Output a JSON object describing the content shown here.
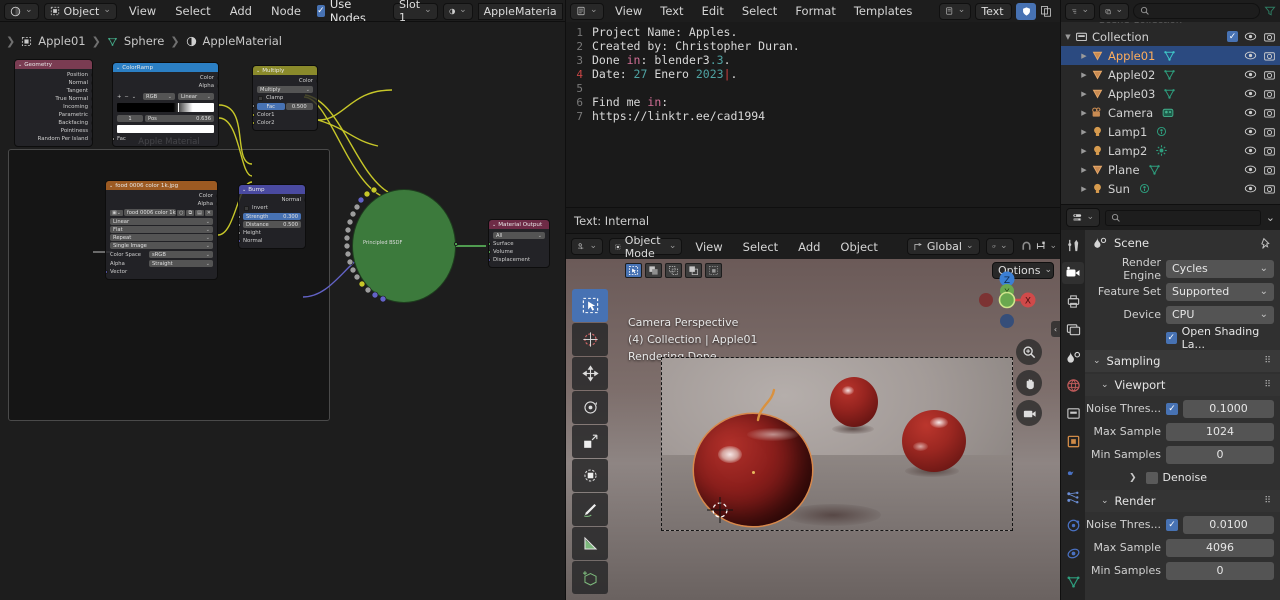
{
  "node_editor": {
    "header": {
      "editor_type_icon": "shader-editor-icon",
      "shader_type": "Object",
      "menus": [
        "View",
        "Select",
        "Add",
        "Node"
      ],
      "use_nodes_label": "Use Nodes",
      "use_nodes_checked": true,
      "slot": "Slot 1",
      "material_icon": "material-icon",
      "material_name": "AppleMateria"
    },
    "breadcrumb": [
      {
        "icon": "object-icon",
        "label": "Apple01"
      },
      {
        "icon": "mesh-data-icon",
        "label": "Sphere"
      },
      {
        "icon": "material-icon",
        "label": "AppleMaterial"
      }
    ],
    "frame_label": "Apple Material",
    "nodes": [
      {
        "name": "Geometry",
        "title": "Geometry",
        "header_color": "#7a3c52",
        "outputs": [
          "Position",
          "Normal",
          "Tangent",
          "True Normal",
          "Incoming",
          "Parametric",
          "Backfacing",
          "Pointiness",
          "Random Per Island"
        ]
      },
      {
        "name": "ColorRamp",
        "title": "ColorRamp",
        "header_color": "#2b7fc4",
        "outputs": [
          "Color",
          "Alpha"
        ],
        "interp_mode": "RGB",
        "interp_type": "Linear",
        "stop_index": "1",
        "pos_label": "Pos",
        "pos_value": "0.636",
        "inputs": [
          "Fac"
        ]
      },
      {
        "name": "Multiply",
        "title": "Multiply",
        "header_color": "#8a8a2b",
        "outputs": [
          "Color"
        ],
        "blend_mode": "Multiply",
        "clamp_label": "Clamp",
        "clamp_checked": false,
        "fac_label": "Fac",
        "fac_value": "0.500",
        "inputs": [
          "Color1",
          "Color2"
        ]
      },
      {
        "name": "ImageTexture",
        "title": "food 0006 color 1k.jpg",
        "header_color": "#9c5a22",
        "outputs": [
          "Color",
          "Alpha"
        ],
        "image_name": "food 0006 color 1k...",
        "interpolation": "Linear",
        "projection": "Flat",
        "extension": "Repeat",
        "source": "Single Image",
        "color_space_label": "Color Space",
        "color_space": "sRGB",
        "alpha_label": "Alpha",
        "alpha_mode": "Straight",
        "inputs": [
          "Vector"
        ]
      },
      {
        "name": "Bump",
        "title": "Bump",
        "header_color": "#4a4aa0",
        "outputs": [
          "Normal"
        ],
        "invert_label": "Invert",
        "invert_checked": false,
        "strength_label": "Strength",
        "strength_value": "0.300",
        "distance_label": "Distance",
        "distance_value": "0.500",
        "inputs": [
          "Height",
          "Normal"
        ]
      },
      {
        "name": "PrincipledBSDF",
        "title": "Principled BSDF",
        "collapsed": true,
        "body_color": "#3c7a3c"
      },
      {
        "name": "MaterialOutput",
        "title": "Material Output",
        "header_color": "#6e2b46",
        "target": "All",
        "inputs": [
          "Surface",
          "Volume",
          "Displacement"
        ]
      }
    ]
  },
  "text_editor": {
    "header": {
      "editor_type_icon": "text-editor-icon",
      "menus": [
        "View",
        "Text",
        "Edit",
        "Select",
        "Format",
        "Templates"
      ],
      "datablock_icon": "text-datablock-icon",
      "datablock_name": "Text",
      "register_checked": true,
      "copy_icon": "duplicate-icon"
    },
    "lines": [
      {
        "n": "1",
        "text": "Project Name: Apples."
      },
      {
        "n": "2",
        "text": "Created by: Christopher Duran."
      },
      {
        "n": "3",
        "text": "Done in: blender3.3."
      },
      {
        "n": "4",
        "text": "Date: 27 Enero 2023."
      },
      {
        "n": "5",
        "text": ""
      },
      {
        "n": "6",
        "text": "Find me in:"
      },
      {
        "n": "7",
        "text": "https://linktr.ee/cad1994"
      }
    ],
    "current_line": "4",
    "status": "Text: Internal"
  },
  "viewport": {
    "header": {
      "mode_icon": "object-mode-icon",
      "mode": "Object Mode",
      "menus": [
        "View",
        "Select",
        "Add",
        "Object"
      ],
      "transform_orientation_icon": "orientation-icon",
      "transform_orientation": "Global",
      "snap_icon": "magnet-icon",
      "pivot_icon": "pivot-icon",
      "proportional_icon": "proportional-edit-icon"
    },
    "select_modes": [
      "set-select-icon",
      "extend-select-icon",
      "subtract-select-icon",
      "invert-select-icon",
      "intersect-select-icon"
    ],
    "options_label": "Options",
    "overlay": {
      "view_name": "Camera Perspective",
      "collection_info": "(4) Collection | Apple01",
      "render_status": "Rendering Done"
    },
    "toolbar": [
      "tweak-select-box-icon",
      "cursor-icon",
      "move-icon",
      "rotate-icon",
      "scale-icon",
      "transform-icon",
      "annotate-icon",
      "measure-icon",
      "add-cube-icon"
    ],
    "gizmo_axes": [
      "X",
      "Y",
      "Z"
    ],
    "nav_buttons": [
      "zoom-icon",
      "pan-hand-icon",
      "camera-view-icon"
    ]
  },
  "outliner": {
    "header": {
      "editor_type_icon": "outliner-icon",
      "display_mode_icon": "view-layer-icon",
      "search_placeholder": "",
      "filter_icon": "filter-icon"
    },
    "root": {
      "label": "Collection",
      "icon": "collection-icon",
      "checked": true
    },
    "items": [
      {
        "label": "Apple01",
        "icon": "mesh-object-icon",
        "data_icon": "mesh-data-icon",
        "selected": true
      },
      {
        "label": "Apple02",
        "icon": "mesh-object-icon",
        "data_icon": "mesh-data-icon",
        "selected": false
      },
      {
        "label": "Apple03",
        "icon": "mesh-object-icon",
        "data_icon": "mesh-data-icon",
        "selected": false
      },
      {
        "label": "Camera",
        "icon": "camera-object-icon",
        "data_icon": "camera-data-icon",
        "selected": false
      },
      {
        "label": "Lamp1",
        "icon": "light-object-icon",
        "data_icon": "point-light-icon",
        "selected": false
      },
      {
        "label": "Lamp2",
        "icon": "light-object-icon",
        "data_icon": "sun-light-icon",
        "selected": false
      },
      {
        "label": "Plane",
        "icon": "mesh-object-icon",
        "data_icon": "mesh-data-icon",
        "selected": false
      },
      {
        "label": "Sun",
        "icon": "light-object-icon",
        "data_icon": "point-light-icon",
        "selected": false
      }
    ]
  },
  "properties": {
    "header": {
      "editor_type_icon": "properties-icon",
      "search_placeholder": "",
      "expand_icon": "chevron-down-icon"
    },
    "tabs": [
      "tool-icon",
      "render-icon",
      "output-icon",
      "view-layer-icon",
      "scene-icon",
      "world-icon",
      "collection-icon",
      "object-icon",
      "modifiers-icon",
      "particles-icon",
      "physics-icon",
      "constraints-icon",
      "data-icon"
    ],
    "active_tab_index": 1,
    "breadcrumb": {
      "icon": "scene-icon",
      "label": "Scene",
      "pin_icon": "pin-icon"
    },
    "fields": [
      {
        "label": "Render Engine",
        "value": "Cycles",
        "type": "dropdown"
      },
      {
        "label": "Feature Set",
        "value": "Supported",
        "type": "dropdown"
      },
      {
        "label": "Device",
        "value": "CPU",
        "type": "dropdown"
      }
    ],
    "osl": {
      "label": "Open Shading La...",
      "checked": true
    },
    "sections": [
      {
        "name": "Sampling",
        "label": "Sampling",
        "expanded": true,
        "subsections": [
          {
            "name": "Viewport",
            "label": "Viewport",
            "expanded": true,
            "rows": [
              {
                "label": "Noise Thres...",
                "checkbox": true,
                "value": "0.1000"
              },
              {
                "label": "Max Sample",
                "value": "1024"
              },
              {
                "label": "Min Samples",
                "value": "0"
              }
            ],
            "denoise": {
              "label": "Denoise",
              "checked": false
            }
          },
          {
            "name": "Render",
            "label": "Render",
            "expanded": true,
            "rows": [
              {
                "label": "Noise Thres...",
                "checkbox": true,
                "value": "0.0100"
              },
              {
                "label": "Max Sample",
                "value": "4096"
              },
              {
                "label": "Min Samples",
                "value": "0"
              }
            ]
          }
        ]
      }
    ]
  },
  "colors": {
    "accent": "#4772b3",
    "select_orange": "#ffae5c",
    "bg_dark": "#1d1d1d",
    "panel": "#303030"
  }
}
